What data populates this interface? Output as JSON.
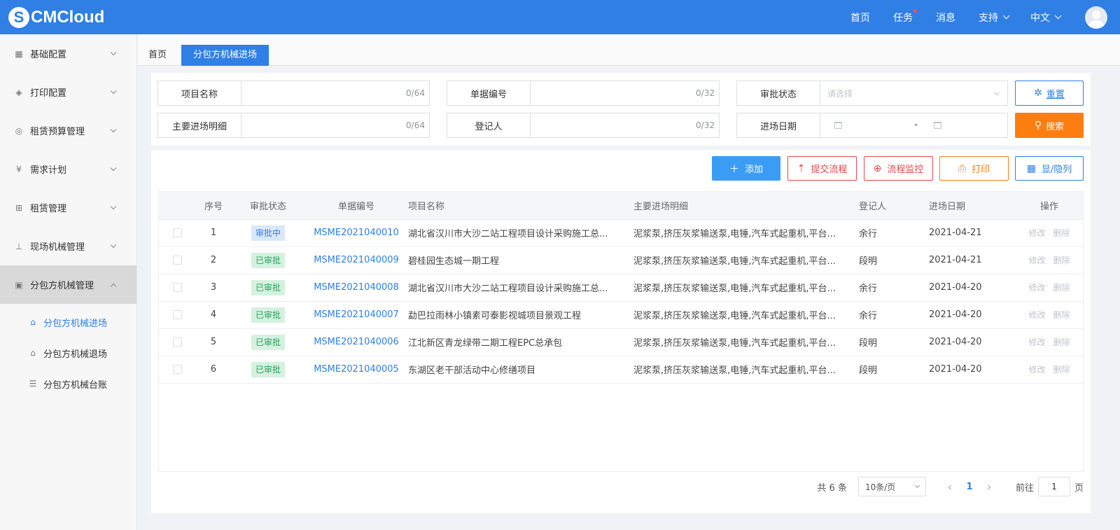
{
  "app": {
    "logo_text": "CMCloud",
    "nav": [
      {
        "label": "首页"
      },
      {
        "label": "任务",
        "has_dot": true
      },
      {
        "label": "消息"
      },
      {
        "label": "支持",
        "dropdown": true
      },
      {
        "label": "中文",
        "dropdown": true
      }
    ]
  },
  "sidebar": {
    "items": [
      {
        "label": "基础配置",
        "icon": "grid-icon"
      },
      {
        "label": "打印配置",
        "icon": "layers-icon"
      },
      {
        "label": "租赁预算管理",
        "icon": "coins-icon"
      },
      {
        "label": "需求计划",
        "icon": "yen-doc-icon"
      },
      {
        "label": "租赁管理",
        "icon": "org-chart-icon"
      },
      {
        "label": "现场机械管理",
        "icon": "crane-icon"
      },
      {
        "label": "分包方机械管理",
        "icon": "machine-icon",
        "active": true
      }
    ],
    "subitems": [
      {
        "label": "分包方机械进场",
        "active": true
      },
      {
        "label": "分包方机械退场"
      },
      {
        "label": "分包方机械台账"
      }
    ]
  },
  "tabs": {
    "home": "首页",
    "current": "分包方机械进场"
  },
  "filters": {
    "project_name": {
      "label": "项目名称",
      "counter": "0/64"
    },
    "doc_no": {
      "label": "单据编号",
      "counter": "0/32"
    },
    "approval_status": {
      "label": "审批状态",
      "placeholder": "请选择"
    },
    "main_detail": {
      "label": "主要进场明细",
      "counter": "0/64"
    },
    "registrant": {
      "label": "登记人",
      "counter": "0/32"
    },
    "entry_date": {
      "label": "进场日期",
      "separator": "-"
    },
    "reset_label": "重置",
    "search_label": "搜索"
  },
  "toolbar": {
    "add": "添加",
    "submit_flow": "提交流程",
    "flow_monitor": "流程监控",
    "print": "打印",
    "columns": "显/隐列"
  },
  "table": {
    "headers": [
      "序号",
      "审批状态",
      "单据编号",
      "项目名称",
      "主要进场明细",
      "登记人",
      "进场日期",
      "操作"
    ],
    "rows": [
      {
        "no": "1",
        "status": "审批中",
        "status_type": "pending",
        "doc": "MSME2021040010",
        "project": "湖北省汉川市大沙二站工程项目设计采购施工总...",
        "detail": "泥浆泵,挤压灰浆输送泵,电锤,汽车式起重机,平台...",
        "person": "余行",
        "date": "2021-04-21"
      },
      {
        "no": "2",
        "status": "已审批",
        "status_type": "done",
        "doc": "MSME2021040009",
        "project": "碧桂园生态城一期工程",
        "detail": "泥浆泵,挤压灰浆输送泵,电锤,汽车式起重机,平台...",
        "person": "段明",
        "date": "2021-04-21"
      },
      {
        "no": "3",
        "status": "已审批",
        "status_type": "done",
        "doc": "MSME2021040008",
        "project": "湖北省汉川市大沙二站工程项目设计采购施工总...",
        "detail": "泥浆泵,挤压灰浆输送泵,电锤,汽车式起重机,平台...",
        "person": "余行",
        "date": "2021-04-20"
      },
      {
        "no": "4",
        "status": "已审批",
        "status_type": "done",
        "doc": "MSME2021040007",
        "project": "勐巴拉雨林小镇素可泰影视城项目景观工程",
        "detail": "泥浆泵,挤压灰浆输送泵,电锤,汽车式起重机,平台...",
        "person": "余行",
        "date": "2021-04-20"
      },
      {
        "no": "5",
        "status": "已审批",
        "status_type": "done",
        "doc": "MSME2021040006",
        "project": "江北新区青龙绿带二期工程EPC总承包",
        "detail": "泥浆泵,挤压灰浆输送泵,电锤,汽车式起重机,平台...",
        "person": "段明",
        "date": "2021-04-20"
      },
      {
        "no": "6",
        "status": "已审批",
        "status_type": "done",
        "doc": "MSME2021040005",
        "project": "东湖区老干部活动中心修缮项目",
        "detail": "泥浆泵,挤压灰浆输送泵,电锤,汽车式起重机,平台...",
        "person": "段明",
        "date": "2021-04-20"
      }
    ],
    "edit_label": "修改",
    "delete_label": "删除"
  },
  "pagination": {
    "total_text": "共 6 条",
    "page_size": "10条/页",
    "prev": "‹",
    "current_page": "1",
    "next": "›",
    "goto_prefix": "前往",
    "goto_value": "1",
    "goto_suffix": "页"
  }
}
